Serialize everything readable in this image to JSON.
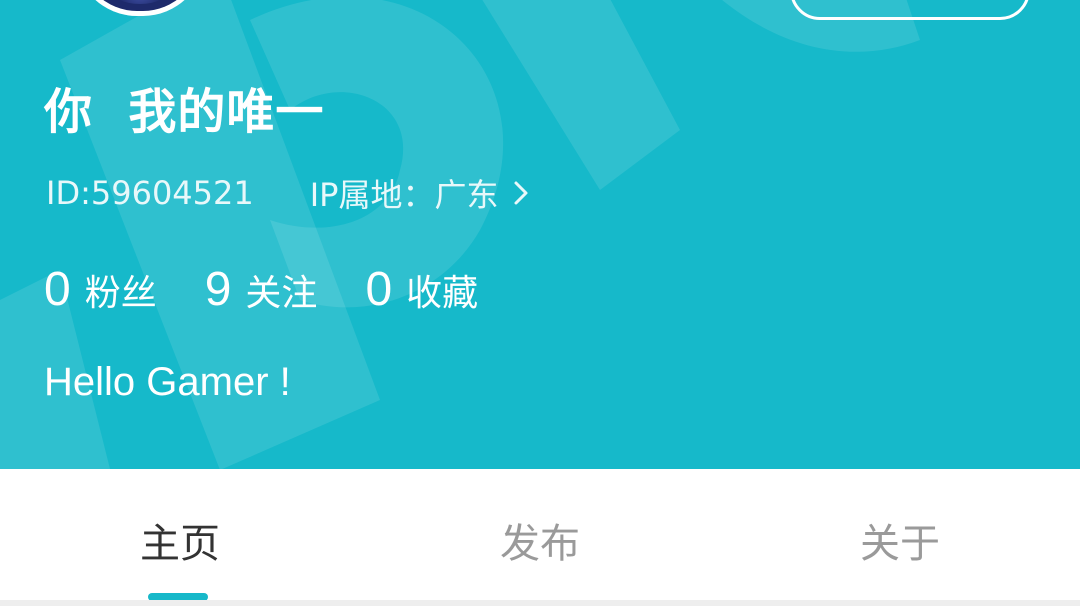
{
  "profile": {
    "nickname": "你  我的唯一",
    "id_text": "ID:59604521",
    "ip_label": "IP属地：广东",
    "bio": "Hello Gamer !"
  },
  "stats": [
    {
      "value": "0",
      "label": "粉丝"
    },
    {
      "value": "9",
      "label": "关注"
    },
    {
      "value": "0",
      "label": "收藏"
    }
  ],
  "tabs": [
    {
      "label": "主页",
      "active": true
    },
    {
      "label": "发布",
      "active": false
    },
    {
      "label": "关于",
      "active": false
    }
  ],
  "colors": {
    "header_bg": "#16b9ca",
    "accent": "#17b8c9",
    "tab_active": "#333333",
    "tab_inactive": "#9a9a9a"
  },
  "icons": {
    "ip_chevron": "chevron-right-icon"
  }
}
